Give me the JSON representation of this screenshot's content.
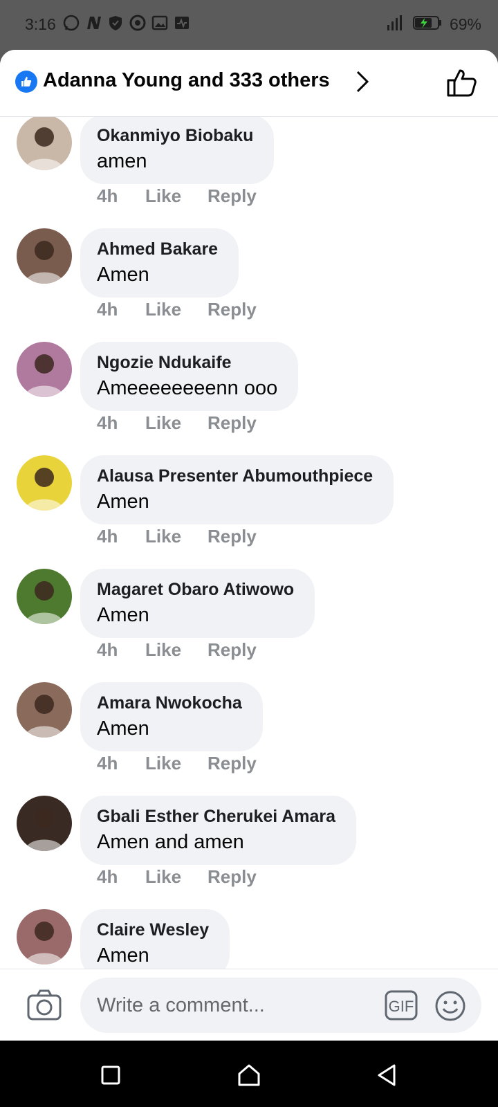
{
  "status_bar": {
    "time": "3:16",
    "battery": "69%"
  },
  "header": {
    "title": "Adanna Young and 333 others"
  },
  "comments": [
    {
      "name": "Okanmiyo Biobaku",
      "text": "amen",
      "time": "4h",
      "like": "Like",
      "reply": "Reply",
      "avatar_color": "#c9b8a8"
    },
    {
      "name": "Ahmed Bakare",
      "text": "Amen",
      "time": "4h",
      "like": "Like",
      "reply": "Reply",
      "avatar_color": "#7a5c4e"
    },
    {
      "name": "Ngozie Ndukaife",
      "text": "Ameeeeeeeenn ooo",
      "time": "4h",
      "like": "Like",
      "reply": "Reply",
      "avatar_color": "#b07a9e"
    },
    {
      "name": "Alausa Presenter Abumouthpiece",
      "text": "Amen",
      "time": "4h",
      "like": "Like",
      "reply": "Reply",
      "avatar_color": "#e8d33a"
    },
    {
      "name": "Magaret Obaro Atiwowo",
      "text": "Amen",
      "time": "4h",
      "like": "Like",
      "reply": "Reply",
      "avatar_color": "#4d7a2e"
    },
    {
      "name": "Amara Nwokocha",
      "text": "Amen",
      "time": "4h",
      "like": "Like",
      "reply": "Reply",
      "avatar_color": "#8a6a5a"
    },
    {
      "name": "Gbali Esther Cherukei Amara",
      "text": "Amen and amen",
      "time": "4h",
      "like": "Like",
      "reply": "Reply",
      "avatar_color": "#3a2a24"
    },
    {
      "name": "Claire Wesley",
      "text": "Amen",
      "time": "",
      "like": "",
      "reply": "",
      "avatar_color": "#9a6a6a"
    }
  ],
  "composer": {
    "placeholder": "Write a comment..."
  },
  "colors": {
    "accent": "#1877f2",
    "bubble": "#f0f2f5",
    "meta_text": "#8a8d91"
  },
  "icons": [
    "whatsapp-icon",
    "news-icon",
    "shield-icon",
    "chrome-icon",
    "gallery-icon",
    "activity-icon",
    "signal-icon",
    "battery-icon",
    "like-badge-icon",
    "chevron-right-icon",
    "thumbs-up-icon",
    "camera-icon",
    "gif-icon",
    "emoji-icon",
    "square-nav-icon",
    "home-nav-icon",
    "back-nav-icon"
  ]
}
